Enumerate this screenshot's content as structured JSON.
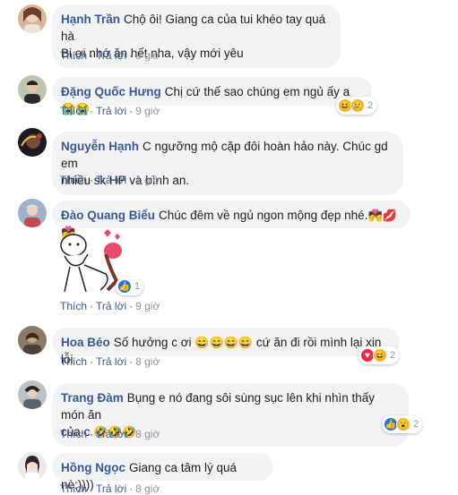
{
  "comments": [
    {
      "name": "Hạnh Trần",
      "text": "Chộ ôi! Giang ca của tui khéo tay quá hà",
      "text2": "Bi ơi nhớ ăn hết nha, vậy mới yêu",
      "like": "Thích",
      "reply": "Trả lời",
      "time": "9 giờ"
    },
    {
      "name": "Đặng Quốc Hưng",
      "text": "Chị cứ thế sao chúng em ngủ ấy ạ",
      "emoji": "😭😭",
      "like": "Thích",
      "reply": "Trả lời",
      "time": "9 giờ",
      "react_count": "2"
    },
    {
      "name": "Nguyễn Hạnh",
      "text": "C ngưỡng mộ cặp đôi hoàn hảo này. Chúc gd em",
      "text2": "nhiều sk HP và bình an.",
      "like": "Thích",
      "reply": "Trả lời",
      "time": "1 giờ"
    },
    {
      "name": "Đào Quang Biểu",
      "text": "Chúc đêm về ngủ ngon mộng đẹp nhé.",
      "emoji": "💏💋💏",
      "like": "Thích",
      "reply": "Trả lời",
      "time": "9 giờ",
      "react_count": "1"
    },
    {
      "name": "Hoa Béo",
      "text": "Số hưởng c ơi",
      "emoji": "😄😄😄😄",
      "text_after": "cứ ăn đi rồi mình lại xin lỗi",
      "like": "Thích",
      "reply": "Trả lời",
      "time": "8 giờ",
      "react_count": "2"
    },
    {
      "name": "Trang Đàm",
      "text": "Bụng e nó đang sôi sùng sục lên khi nhìn thấy món ăn",
      "text2": "của c",
      "emoji": "🤣🤣🤣",
      "like": "Thích",
      "reply": "Trả lời",
      "time": "8 giờ",
      "react_count": "2"
    },
    {
      "name": "Hồng Ngọc",
      "text": "Giang ca tâm lý quá nè:))))",
      "like": "Thích",
      "reply": "Trả lời",
      "time": "8 giờ"
    }
  ],
  "icons": {
    "haha": "😆",
    "sad": "😢",
    "love": "♥",
    "like": "👍",
    "wow": "😮"
  }
}
